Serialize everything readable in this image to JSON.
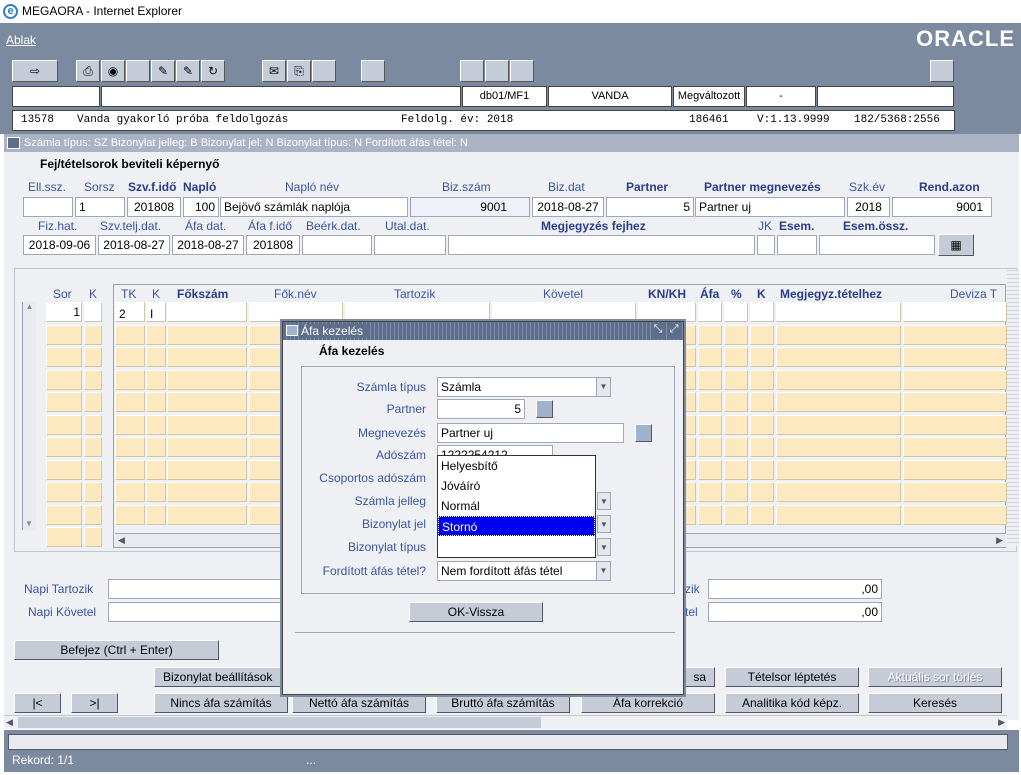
{
  "window": {
    "title": "MEGAORA - Internet Explorer"
  },
  "menu": {
    "ablak": "Ablak",
    "logo": "ORACLE"
  },
  "status_row": {
    "db": "db01/MF1",
    "user": "VANDA",
    "state": "Megváltozott",
    "dash": "-"
  },
  "info": {
    "id": "13578",
    "desc": "Vanda gyakorló próba feldolgozás",
    "year_label": "Feldolg. év: 2018",
    "num": "186461",
    "version": "V:1.13.9999",
    "code": "182/5368:2556"
  },
  "form": {
    "title": "Számla típus: SZ Bizonylat jelleg: B Bizonylat jel: N Bizonylat típus: N Fordított áfás tétel: N",
    "heading": "Fej/tételsorok beviteli képernyő",
    "labels": {
      "ell": "Ell.ssz.",
      "sorsz": "Sorsz",
      "szv": "Szv.f.idő",
      "naplo": "Napló",
      "naplonev": "Napló név",
      "bizszam": "Biz.szám",
      "bizdat": "Biz.dat",
      "partner": "Partner",
      "partnernev": "Partner megnevezés",
      "szkev": "Szk.év",
      "rendazon": "Rend.azon",
      "fizhat": "Fiz.hat.",
      "szvtelj": "Szv.telj.dat.",
      "afadat": "Áfa dat.",
      "afafido": "Áfa f.idő",
      "beerk": "Beérk.dat.",
      "utal": "Utal.dat.",
      "megj": "Megjegyzés fejhez",
      "jk": "JK",
      "esem": "Esem.",
      "esemossz": "Esem.össz."
    },
    "values": {
      "sorsz": "1",
      "szv": "201808",
      "naplo": "100",
      "naplonev": "Bejövő számlák naplója",
      "bizszam": "9001",
      "bizdat": "2018-08-27",
      "partner": "5",
      "partnernev": "Partner uj",
      "szkev": "2018",
      "rendazon": "9001",
      "fizhat": "2018-09-06",
      "szvtelj": "2018-08-27",
      "afadat": "2018-08-27",
      "afafido": "201808"
    }
  },
  "grid": {
    "left_headers": {
      "sor": "Sor",
      "k": "K"
    },
    "headers": {
      "tk": "TK",
      "k": "K",
      "fokszam": "Főkszám",
      "foknev": "Fők.név",
      "tartozik": "Tartozik",
      "kovetel": "Követel",
      "knkh": "KN/KH",
      "afa": "Áfa",
      "pct": "%",
      "k2": "K",
      "megj": "Megjegyz.tételhez",
      "deviza": "Deviza T"
    },
    "row1": {
      "sor": "1",
      "tk": "2",
      "k": "I"
    }
  },
  "totals": {
    "napi_tartozik": "Napi Tartozik",
    "napi_kovetel": "Napi Követel",
    "osszeg1": ",00",
    "osszeg2": ",00",
    "zik": "zik",
    "tel": "tel"
  },
  "buttons": {
    "befejez": "Befejez (Ctrl + Enter)",
    "biz_beall": "Bizonylat beállítások",
    "sa": "sa",
    "tetelsor": "Tételsor léptetés",
    "aktualis": "Aktuális sor törlés",
    "first": "|<",
    "last": ">|",
    "nincs_afa": "Nincs áfa számítás",
    "netto": "Nettó áfa számítás",
    "brutto": "Bruttó áfa számítás",
    "afa_korr": "Áfa korrekció",
    "analitika": "Analitika kód képz.",
    "kereses": "Keresés"
  },
  "status": {
    "rekord": "Rekord: 1/1",
    "dots": "..."
  },
  "modal": {
    "title": "Áfa kezelés",
    "heading": "Áfa kezelés",
    "labels": {
      "szamla_tipus": "Számla típus",
      "partner": "Partner",
      "megnevezes": "Megnevezés",
      "adoszam": "Adószám",
      "csoportos": "Csoportos adószám",
      "szamla_jelleg": "Számla jelleg",
      "biz_jel": "Bizonylat jel",
      "biz_tipus": "Bizonylat típus",
      "forditott": "Fordított áfás tétel?"
    },
    "values": {
      "szamla_tipus": "Számla",
      "partner": "5",
      "megnevezes": "Partner uj",
      "adoszam": "1222254212",
      "forditott": "Nem fordított áfás tétel"
    },
    "dropdown": [
      "Helyesbítő",
      "Jóváíró",
      "Normál",
      "Stornó"
    ],
    "ok": "OK-Vissza"
  }
}
